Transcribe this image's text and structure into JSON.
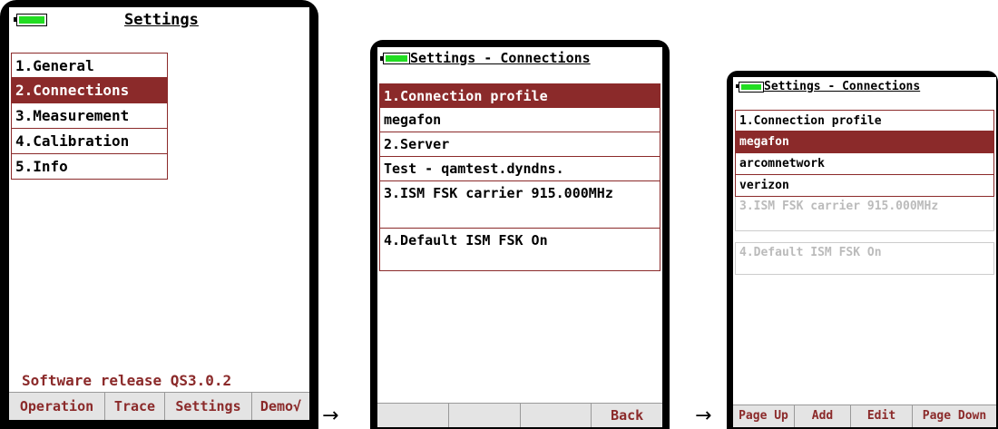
{
  "arrow": "→",
  "screen1": {
    "title": "Settings",
    "menu": [
      "1.General",
      "2.Connections",
      "3.Measurement",
      "4.Calibration",
      "5.Info"
    ],
    "release": "Software release QS3.0.2",
    "footer": [
      "Operation",
      "Trace",
      "Settings",
      "Demo√"
    ]
  },
  "screen2": {
    "title": "Settings - Connections",
    "items": [
      "1.Connection profile",
      "megafon",
      "2.Server",
      "Test - qamtest.dyndns.",
      "3.ISM FSK carrier 915.000MHz",
      "4.Default ISM FSK  On"
    ],
    "footer": [
      "",
      "",
      "",
      "Back"
    ]
  },
  "screen3": {
    "title": "Settings - Connections",
    "items": [
      "1.Connection profile",
      "megafon",
      "arcomnetwork",
      "verizon",
      "3.ISM FSK carrier 915.000MHz",
      "4.Default ISM FSK  On"
    ],
    "footer": [
      "Page Up",
      "Add",
      "Edit",
      "Page Down"
    ]
  },
  "colors": {
    "accent": "#8b2a2a",
    "battery": "#22dd22",
    "footer_bg": "#e4e4e4"
  }
}
